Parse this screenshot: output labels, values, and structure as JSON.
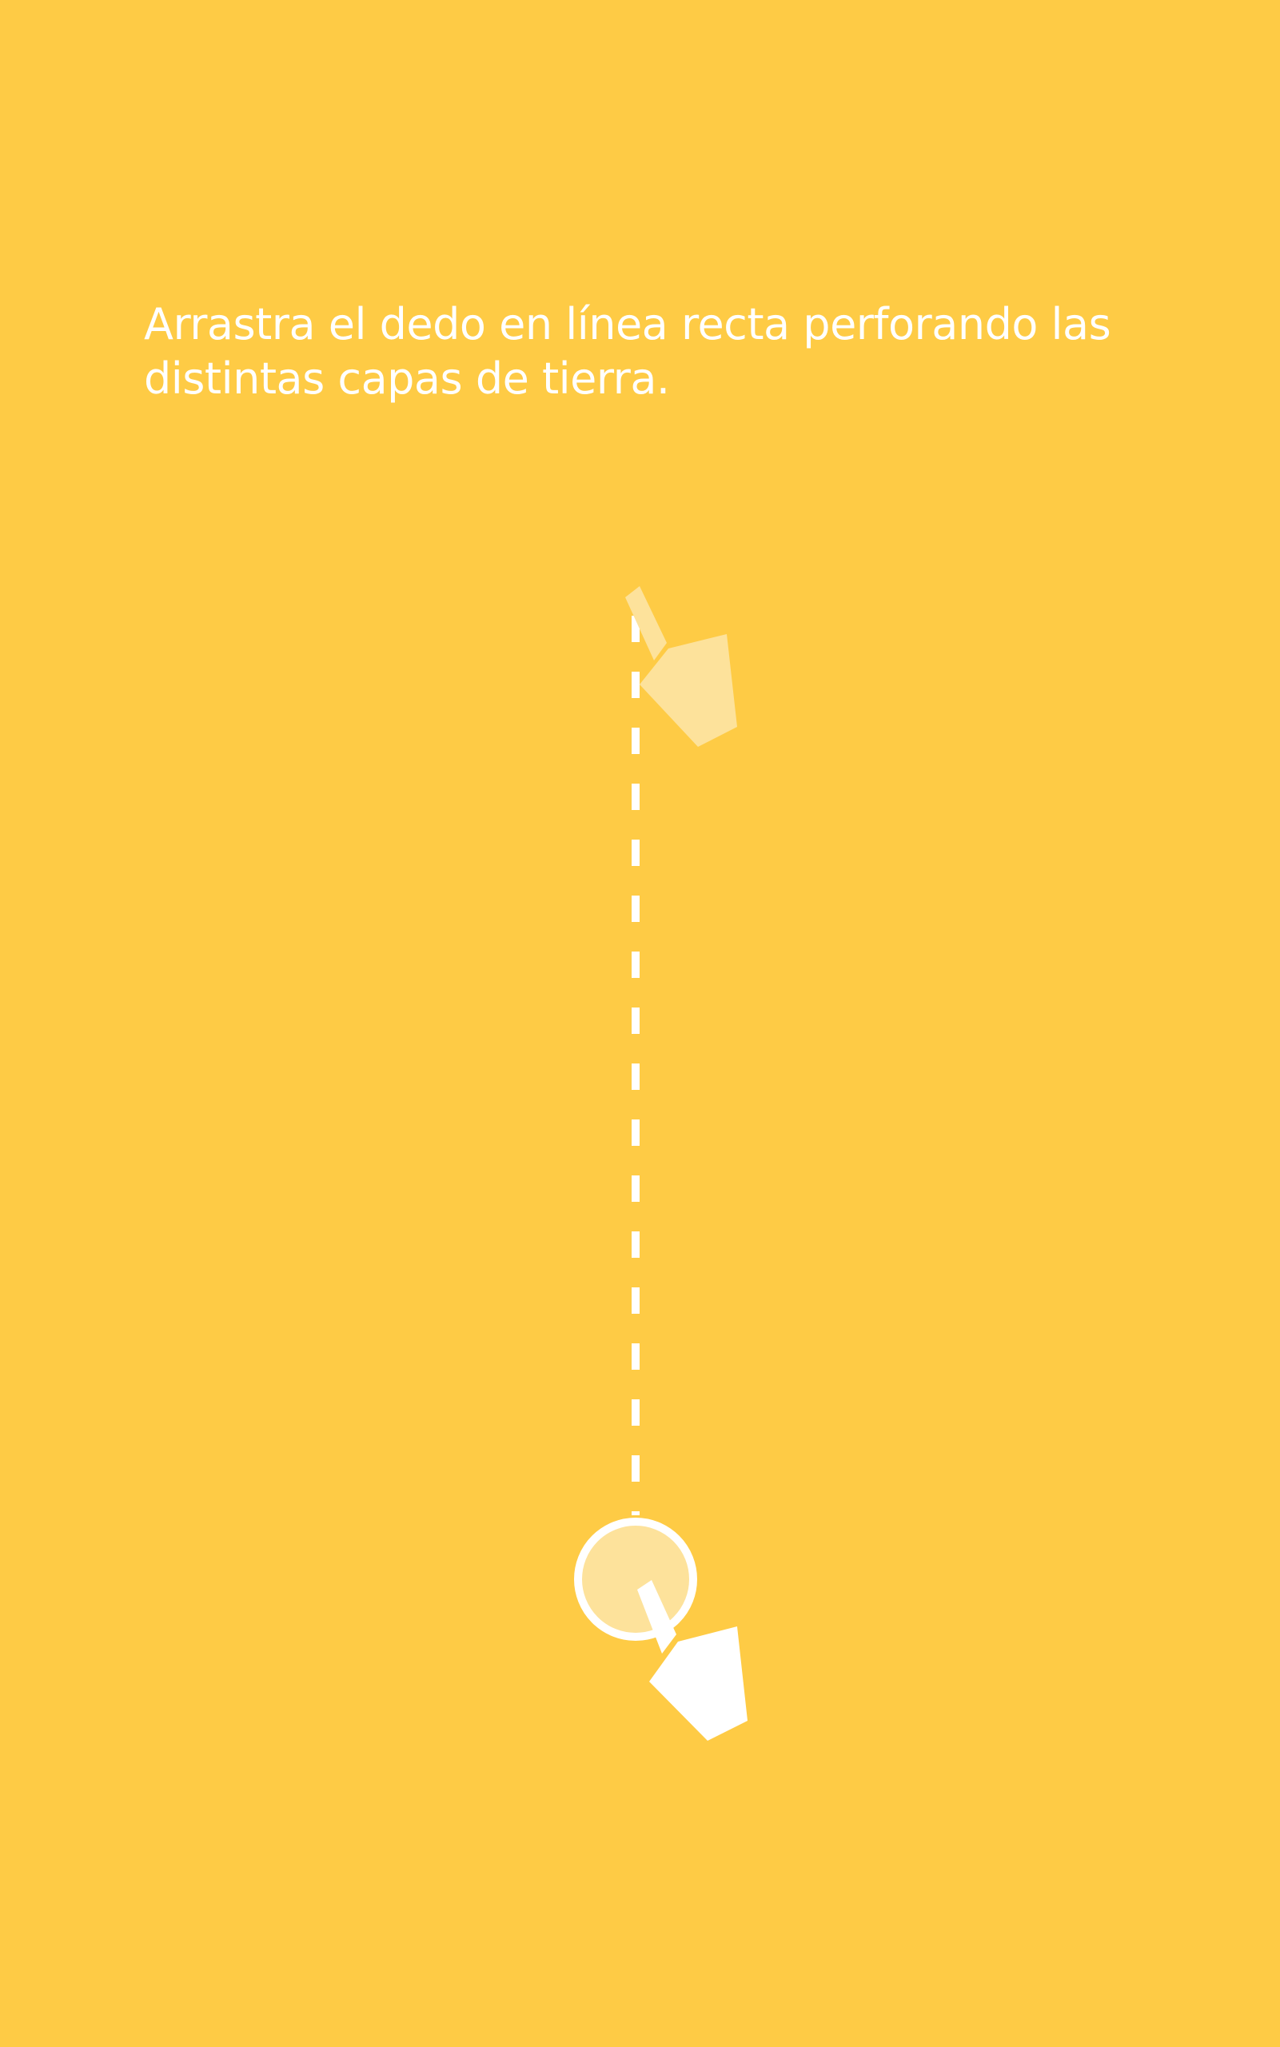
{
  "screen": {
    "background_color": "#FECB45",
    "instruction_text": "Arrastra el dedo en línea recta perforando las distintas capas de tierra."
  },
  "gesture_hint": {
    "icon": "swipe-down-gesture-icon",
    "direction": "down",
    "path_style": "dashed",
    "path_color": "#FFFFFF",
    "start_hand_color": "#FDE29B",
    "end_hand_color": "#FFFFFF",
    "touch_circle_fill": "#FDE29B",
    "touch_circle_stroke": "#FFFFFF"
  }
}
